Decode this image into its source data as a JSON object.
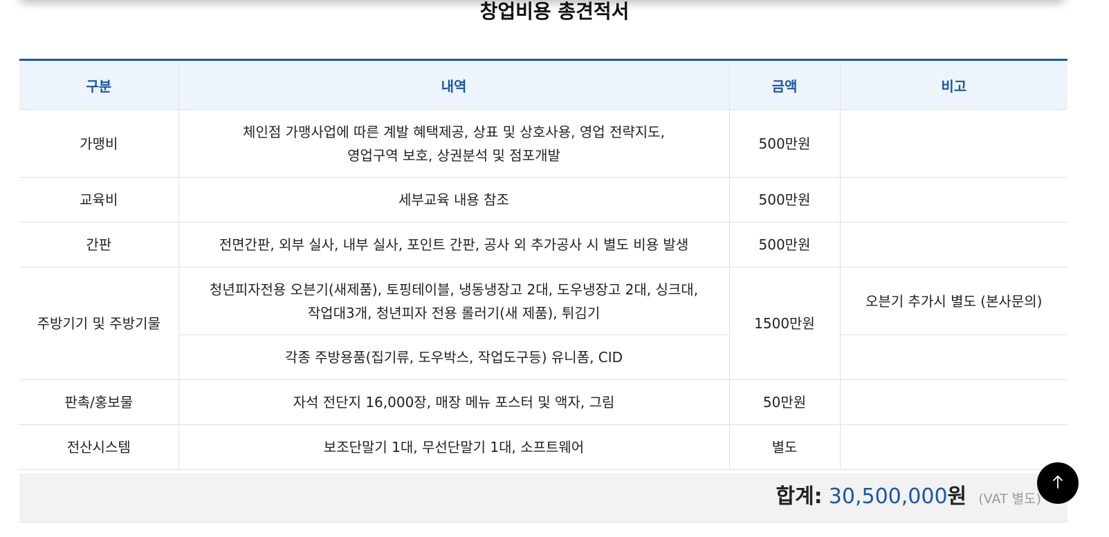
{
  "page": {
    "title": "창업비용 총견적서"
  },
  "table": {
    "headers": {
      "category": "구분",
      "details": "내역",
      "amount": "금액",
      "note": "비고"
    },
    "rows": [
      {
        "category": "가맹비",
        "details_line1": "체인점 가맹사업에 따른 계발 혜택제공, 상표 및 상호사용, 영업 전략지도,",
        "details_line2": "영업구역 보호, 상권분석 및 점포개발",
        "amount": "500만원",
        "note": ""
      },
      {
        "category": "교육비",
        "details": "세부교육 내용 참조",
        "amount": "500만원",
        "note": ""
      },
      {
        "category": "간판",
        "details": "전면간판, 외부 실사, 내부 실사, 포인트 간판, 공사 외 추가공사 시 별도 비용 발생",
        "amount": "500만원",
        "note": ""
      },
      {
        "category": "주방기기 및 주방기물",
        "details_line1": "청년피자전용 오븐기(새제품), 토핑테이블, 냉동냉장고 2대, 도우냉장고 2대, 싱크대,",
        "details_line2": "작업대3개, 청년피자 전용 롤러기(새 제품), 튀김기",
        "details_sub": "각종 주방용품(집기류, 도우박스, 작업도구등) 유니폼, CID",
        "amount": "1500만원",
        "note": "오븐기 추가시 별도 (본사문의)",
        "note_sub": ""
      },
      {
        "category": "판촉/홍보물",
        "details": "자석 전단지 16,000장, 매장 메뉴 포스터 및 액자, 그림",
        "amount": "50만원",
        "note": ""
      },
      {
        "category": "전산시스템",
        "details": "보조단말기 1대, 무선단말기 1대, 소프트웨어",
        "amount": "별도",
        "note": ""
      }
    ]
  },
  "total": {
    "label": "합계:",
    "amount": "30,500,000",
    "unit": "원",
    "note": "(VAT 별도)"
  },
  "scroll_top": {
    "icon": "arrow-up-icon"
  },
  "colors": {
    "accent": "#1a56a6",
    "header_bg": "#eef4fb",
    "total_bg": "#f2f2f2"
  }
}
